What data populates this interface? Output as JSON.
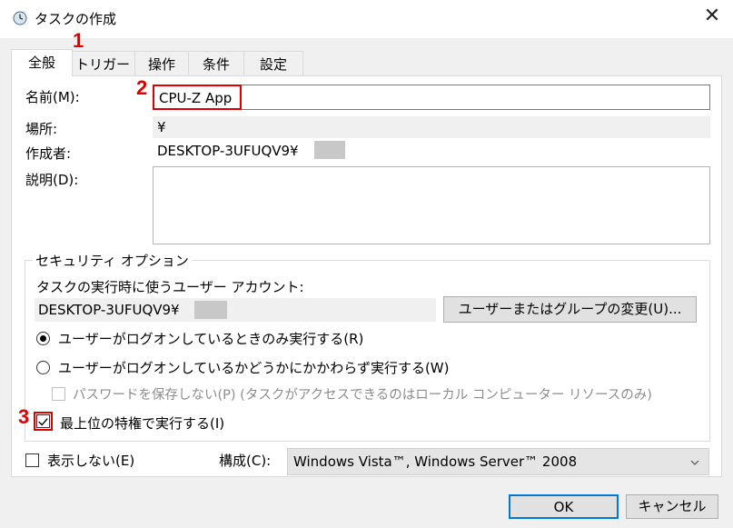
{
  "window": {
    "title": "タスクの作成",
    "clock_icon": "clock-icon",
    "close_icon": "close-icon",
    "close_glyph": "✕"
  },
  "tabs": [
    {
      "label": "全般",
      "active": true
    },
    {
      "label": "トリガー"
    },
    {
      "label": "操作"
    },
    {
      "label": "条件"
    },
    {
      "label": "設定"
    }
  ],
  "steps": {
    "one": "1",
    "two": "2",
    "three": "3"
  },
  "general": {
    "name_label": "名前(M):",
    "name_value": "CPU-Z App",
    "location_label": "場所:",
    "location_value": "¥",
    "author_label": "作成者:",
    "author_value": "DESKTOP-3UFUQV9¥",
    "description_label": "説明(D):",
    "description_value": ""
  },
  "security": {
    "group_label": "セキュリティ オプション",
    "account_label": "タスクの実行時に使うユーザー アカウント:",
    "account_value": "DESKTOP-3UFUQV9¥",
    "change_button": "ユーザーまたはグループの変更(U)...",
    "radio_logged_on": "ユーザーがログオンしているときのみ実行する(R)",
    "radio_whether": "ユーザーがログオンしているかどうかにかかわらず実行する(W)",
    "no_store_password": "パスワードを保存しない(P) (タスクがアクセスできるのはローカル コンピューター リソースのみ)",
    "highest_privileges": "最上位の特権で実行する(I)"
  },
  "footer": {
    "hidden_label": "表示しない(E)",
    "configure_label": "構成(C):",
    "configure_value": "Windows Vista™, Windows Server™ 2008",
    "ok_button": "OK",
    "cancel_button": "キャンセル",
    "dropdown_icon": "chevron-down-icon"
  },
  "colors": {
    "highlight": "#e00000",
    "focus_blue": "#0078d7",
    "background": "#f0f0f0"
  }
}
